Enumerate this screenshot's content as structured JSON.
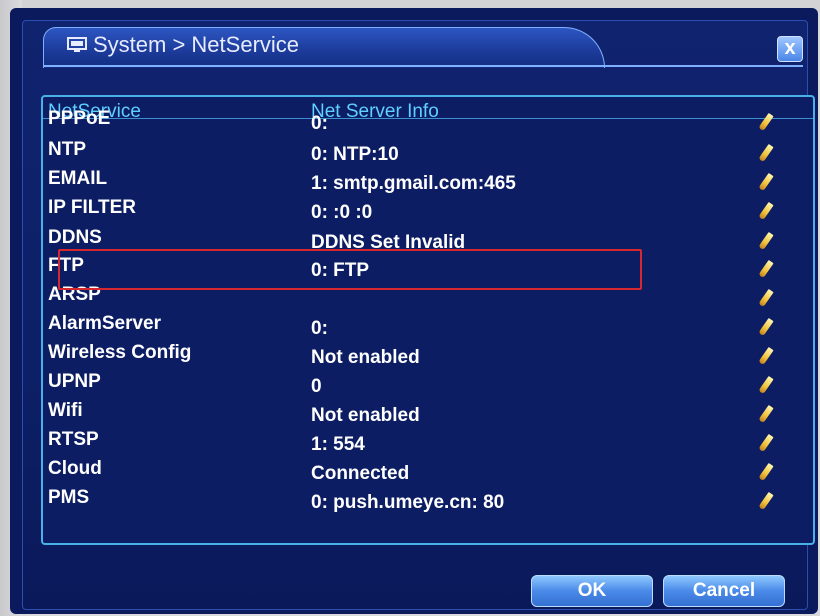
{
  "window": {
    "title": "System > NetService",
    "close_label": "x"
  },
  "table": {
    "headers": [
      "NetService",
      "Net Server Info"
    ],
    "rows": [
      {
        "name": "PPPoE",
        "info": "0:"
      },
      {
        "name": "NTP",
        "info": "0: NTP:10"
      },
      {
        "name": "EMAIL",
        "info": "1: smtp.gmail.com:465"
      },
      {
        "name": "IP FILTER",
        "info": "0: :0 :0"
      },
      {
        "name": "DDNS",
        "info": "DDNS Set Invalid"
      },
      {
        "name": "FTP",
        "info": "0: FTP"
      },
      {
        "name": "ARSP",
        "info": ""
      },
      {
        "name": "AlarmServer",
        "info": "0:"
      },
      {
        "name": "Wireless Config",
        "info": "Not enabled"
      },
      {
        "name": "UPNP",
        "info": "0"
      },
      {
        "name": "Wifi",
        "info": "Not enabled"
      },
      {
        "name": "RTSP",
        "info": "1: 554"
      },
      {
        "name": "Cloud",
        "info": "Connected"
      },
      {
        "name": "PMS",
        "info": "0: push.umeye.cn: 80"
      }
    ],
    "selected_row": "EMAIL"
  },
  "buttons": {
    "ok": "OK",
    "cancel": "Cancel"
  },
  "icons": {
    "title": "monitor-icon",
    "row_edit": "pencil-icon",
    "close": "close-icon"
  },
  "colors": {
    "background": "#0d1f66",
    "header_text": "#5fd0ff",
    "border": "#4ab0e8",
    "highlight": "#d8282f",
    "button": "#4a8ae8"
  }
}
